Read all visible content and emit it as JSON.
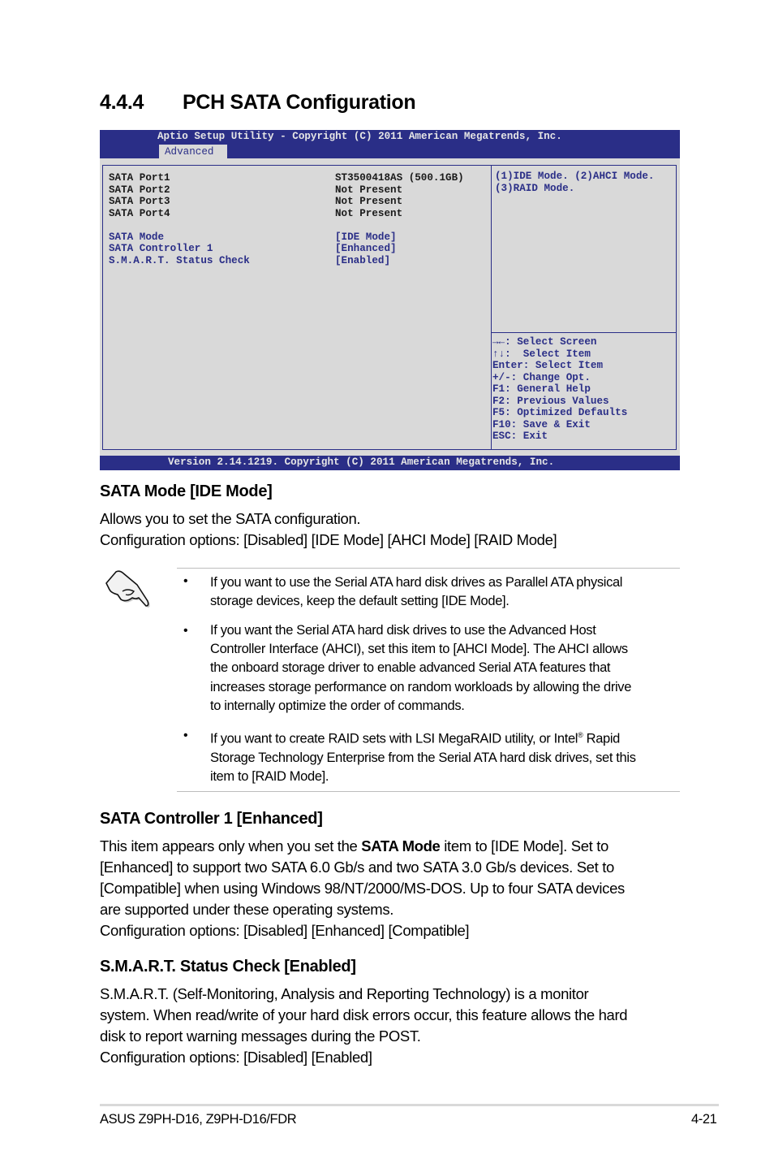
{
  "section": {
    "number": "4.4.4",
    "title": "PCH SATA Configuration"
  },
  "bios": {
    "title_bar": "Aptio Setup Utility - Copyright (C) 2011 American Megatrends, Inc.",
    "active_tab": "Advanced",
    "ports": [
      {
        "label": "SATA Port1",
        "value": "ST3500418AS (500.1GB)"
      },
      {
        "label": "SATA Port2",
        "value": "Not Present"
      },
      {
        "label": "SATA Port3",
        "value": "Not Present"
      },
      {
        "label": "SATA Port4",
        "value": "Not Present"
      }
    ],
    "settings": [
      {
        "label": "SATA Mode",
        "value": "[IDE Mode]"
      },
      {
        "label": "SATA Controller 1",
        "value": "[Enhanced]"
      },
      {
        "label": "S.M.A.R.T. Status Check",
        "value": "[Enabled]"
      }
    ],
    "help_lines": [
      "(1)IDE Mode. (2)AHCI Mode.",
      "(3)RAID Mode."
    ],
    "key_help": [
      "→←: Select Screen",
      "↑↓:  Select Item",
      "Enter: Select Item",
      "+/-: Change Opt.",
      "F1: General Help",
      "F2: Previous Values",
      "F5: Optimized Defaults",
      "F10: Save & Exit",
      "ESC: Exit"
    ],
    "version_bar": "Version 2.14.1219. Copyright (C) 2011 American Megatrends, Inc.",
    "colors": {
      "frame": "#2a2e87",
      "background": "#d9d9d9",
      "bar_text": "#e6e6e6"
    }
  },
  "sata_mode": {
    "heading": "SATA Mode [IDE Mode]",
    "line1": "Allows you to set the SATA configuration.",
    "line2": "Configuration options: [Disabled] [IDE Mode] [AHCI Mode] [RAID Mode]"
  },
  "note": {
    "icon": "pointing-hand-icon",
    "bullet_glyph": "•",
    "items": [
      {
        "lines": [
          "If you want to use the Serial ATA hard disk drives as Parallel ATA physical",
          "storage devices, keep the default setting [IDE Mode]."
        ]
      },
      {
        "lines": [
          "If you want the Serial ATA hard disk drives to use the Advanced Host",
          "Controller Interface (AHCI), set this item to [AHCI Mode]. The AHCI allows",
          "the onboard storage driver to enable advanced Serial ATA features that",
          "increases storage performance on random workloads by allowing the drive",
          "to internally optimize the order of commands."
        ]
      },
      {
        "line1_pre": "If you want to create RAID sets with LSI MegaRAID utility, or Intel",
        "line1_sup": "®",
        "line1_post": " Rapid",
        "lines": [
          "Storage Technology Enterprise from the Serial ATA hard disk drives, set this",
          "item to [RAID Mode]."
        ]
      }
    ]
  },
  "sata_controller": {
    "heading": "SATA Controller 1 [Enhanced]",
    "line1_pre": "This item appears only when you set the ",
    "line1_bold": "SATA Mode",
    "line1_post": " item to [IDE Mode]. Set to",
    "lines": [
      "[Enhanced] to support two SATA 6.0 Gb/s and two SATA 3.0 Gb/s devices. Set to",
      "[Compatible] when using Windows 98/NT/2000/MS-DOS. Up to four SATA devices",
      "are supported under these operating systems.",
      "Configuration options: [Disabled] [Enhanced] [Compatible]"
    ]
  },
  "smart": {
    "heading": "S.M.A.R.T. Status Check [Enabled]",
    "lines": [
      "S.M.A.R.T. (Self-Monitoring, Analysis and Reporting Technology) is a monitor",
      "system. When read/write of your hard disk errors occur, this feature allows the hard",
      "disk to report warning messages during the POST.",
      "Configuration options: [Disabled] [Enabled]"
    ]
  },
  "footer": {
    "product": "ASUS Z9PH-D16, Z9PH-D16/FDR",
    "page": "4-21"
  }
}
